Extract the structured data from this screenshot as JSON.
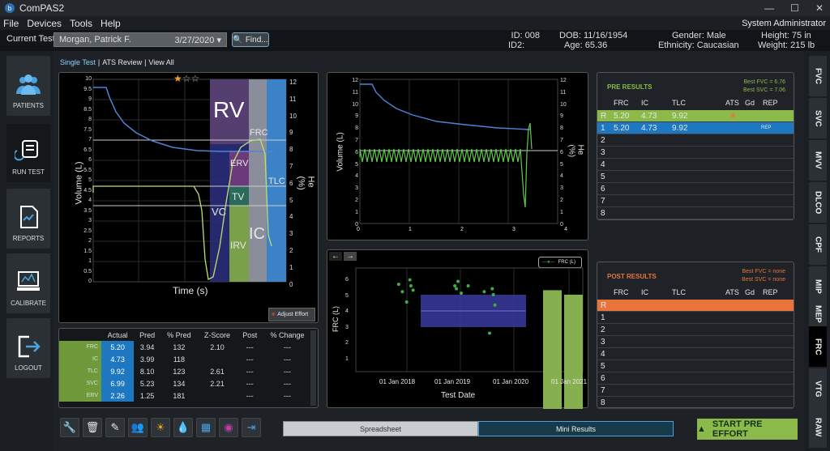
{
  "app": {
    "title": "ComPAS2",
    "logo_letter": "b",
    "win_min": "—",
    "win_max": "☐",
    "win_close": "✕"
  },
  "menu": {
    "items": [
      "File",
      "Devices",
      "Tools",
      "Help"
    ],
    "user": "System Administrator"
  },
  "header": {
    "current_test_label": "Current Test:",
    "patient": "Morgan, Patrick F.",
    "test_date": "3/27/2020",
    "find_label": "Find...",
    "id_label": "ID:",
    "id_value": "008",
    "id2_label": "ID2:",
    "dob_label": "DOB:",
    "dob_value": "11/16/1954",
    "age_label": "Age:",
    "age_value": "65.36",
    "gender_label": "Gender:",
    "gender_value": "Male",
    "ethnicity_label": "Ethnicity:",
    "ethnicity_value": "Caucasian",
    "height_label": "Height:",
    "height_value": "75 in",
    "weight_label": "Weight:",
    "weight_value": "215 lb"
  },
  "sidebar": [
    "PATIENTS",
    "RUN TEST",
    "REPORTS",
    "CALIBRATE",
    "LOGOUT"
  ],
  "view_tabs": {
    "single": "Single Test",
    "sep": "|",
    "ats": "ATS Review",
    "all": "View All"
  },
  "chart1": {
    "ylabel": "Volume (L)",
    "ylabel2": "He (%)",
    "xlabel": "Time (s)",
    "yticks": [
      "10",
      "9.5",
      "9",
      "8.5",
      "8",
      "7.5",
      "7",
      "6.5",
      "6",
      "5.5",
      "5",
      "4.5",
      "4",
      "3.5",
      "3",
      "2.5",
      "2",
      "1.5",
      "1",
      "0.5",
      "0"
    ],
    "yticks2": [
      "12",
      "11",
      "10",
      "9",
      "8",
      "7",
      "6",
      "5",
      "4",
      "3",
      "2",
      "1",
      "0"
    ],
    "labels": {
      "rv": "RV",
      "frc": "FRC",
      "erv": "ERV",
      "tv": "TV",
      "vc": "VC",
      "tlc": "TLC",
      "irv": "IRV",
      "ic": "IC"
    },
    "stars": [
      "★",
      "☆",
      "☆"
    ],
    "adjust_label": "Adjust Effort"
  },
  "chart2": {
    "ylabel": "Volume (L)",
    "ylabel2": "He (%)",
    "yticks": [
      "12",
      "11",
      "10",
      "9",
      "8",
      "7",
      "6",
      "5",
      "4",
      "3",
      "2",
      "1",
      "0"
    ],
    "xticks": [
      "0",
      "1",
      "2",
      "3",
      "4"
    ]
  },
  "chart_data": {
    "type": "scatter",
    "ylabel": "FRC (L)",
    "xlabel": "Test Date",
    "legend": "FRC (L)",
    "xticks": [
      "01 Jan 2018",
      "01 Jan 2019",
      "01 Jan 2020",
      "01 Jan 2021"
    ],
    "yticks": [
      "6",
      "5",
      "4",
      "3",
      "2",
      "1"
    ],
    "ylim": [
      0,
      7
    ],
    "points": [
      [
        2018.35,
        5.9
      ],
      [
        2018.42,
        5.4
      ],
      [
        2018.5,
        4.7
      ],
      [
        2018.56,
        6.2
      ],
      [
        2018.58,
        5.8
      ],
      [
        2018.62,
        5.5
      ],
      [
        2019.4,
        5.8
      ],
      [
        2019.43,
        5.6
      ],
      [
        2019.46,
        6.1
      ],
      [
        2019.52,
        5.3
      ],
      [
        2019.65,
        5.8
      ],
      [
        2019.95,
        5.4
      ],
      [
        2020.05,
        2.6
      ],
      [
        2020.1,
        5.6
      ],
      [
        2020.12,
        5.2
      ],
      [
        2020.15,
        4.5
      ]
    ],
    "bars": [
      5.5,
      5.2
    ],
    "band": [
      3,
      5
    ]
  },
  "summary": {
    "headers": [
      "",
      "Actual",
      "Pred",
      "% Pred",
      "Z-Score",
      "Post",
      "% Change"
    ],
    "rows": [
      [
        "FRC",
        "5.20",
        "3.94",
        "132",
        "2.10",
        "---",
        "---"
      ],
      [
        "IC",
        "4.73",
        "3.99",
        "118",
        "",
        "---",
        "---"
      ],
      [
        "TLC",
        "9.92",
        "8.10",
        "123",
        "2.61",
        "---",
        "---"
      ],
      [
        "SVC",
        "6.99",
        "5.23",
        "134",
        "2.21",
        "---",
        "---"
      ],
      [
        "ERV",
        "2.26",
        "1.25",
        "181",
        "",
        "---",
        "---"
      ]
    ]
  },
  "pre_results": {
    "title": "PRE RESULTS",
    "best_fvc": "Best FVC = 6.76",
    "best_svc": "Best SVC = 7.06",
    "headers": [
      "FRC",
      "IC",
      "TLC",
      "ATS",
      "Gd",
      "REP"
    ],
    "rows": [
      {
        "idx": "R",
        "frc": "5.20",
        "ic": "4.73",
        "tlc": "9.92",
        "ats": "★",
        "rep": ""
      },
      {
        "idx": "1",
        "frc": "5.20",
        "ic": "4.73",
        "tlc": "9.92",
        "ats": "",
        "rep": "REP"
      },
      {
        "idx": "2"
      },
      {
        "idx": "3"
      },
      {
        "idx": "4"
      },
      {
        "idx": "5"
      },
      {
        "idx": "6"
      },
      {
        "idx": "7"
      },
      {
        "idx": "8"
      }
    ]
  },
  "post_results": {
    "title": "POST RESULTS",
    "best_fvc": "Best FVC = none",
    "best_svc": "Best SVC = none",
    "headers": [
      "FRC",
      "IC",
      "TLC",
      "ATS",
      "Gd",
      "REP"
    ],
    "rows": [
      "R",
      "1",
      "2",
      "3",
      "4",
      "5",
      "6",
      "7",
      "8"
    ]
  },
  "right_tabs": [
    "FVC",
    "SVC",
    "MVV",
    "DLCO",
    "CPF",
    "MIP",
    "MEP",
    "FRC",
    "VTG",
    "RAW"
  ],
  "toolbar": [
    "🔧",
    "🗑",
    "✎",
    "👥",
    "☀",
    "💧",
    "▦",
    "◉",
    "⇥"
  ],
  "bottom": {
    "spreadsheet": "Spreadsheet",
    "mini": "Mini Results",
    "start": "START PRE EFFORT"
  },
  "colors": {
    "accent": "#1d78c1",
    "green": "#8bba4a",
    "orange": "#e8743c"
  }
}
